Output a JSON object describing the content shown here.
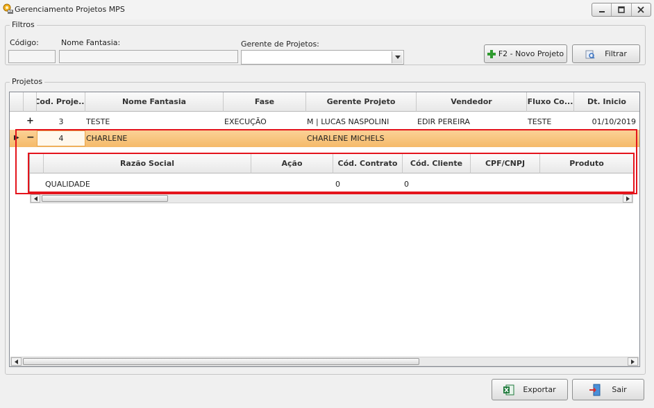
{
  "window": {
    "title": "Gerenciamento Projetos MPS",
    "icon": "app-logo-icon"
  },
  "filtros": {
    "legend": "Filtros",
    "codigo_label": "Código:",
    "codigo_value": "",
    "nome_fantasia_label": "Nome Fantasia:",
    "nome_fantasia_value": "",
    "gerente_label": "Gerente de Projetos:",
    "gerente_value": "",
    "novo_projeto_label": "F2 - Novo Projeto",
    "filtrar_label": "Filtrar"
  },
  "projetos": {
    "legend": "Projetos",
    "columns": [
      "Cod. Proje...",
      "Nome Fantasia",
      "Fase",
      "Gerente Projeto",
      "Vendedor",
      "Fluxo Co...",
      "Dt. Inicio"
    ],
    "rows": [
      {
        "expander": "+",
        "cod": "3",
        "nome": "TESTE",
        "fase": "EXECUÇÃO",
        "gerente": "M | LUCAS NASPOLINI",
        "vendedor": "EDIR PEREIRA",
        "fluxo": "TESTE",
        "dt_inicio": "01/10/2019"
      },
      {
        "expander": "−",
        "cod": "4",
        "nome": "CHARLENE",
        "fase": "",
        "gerente": "CHARLENE MICHELS",
        "vendedor": "",
        "fluxo": "",
        "dt_inicio": ""
      }
    ],
    "detail": {
      "columns": [
        "Razão Social",
        "Ação",
        "Cód. Contrato",
        "Cód. Cliente",
        "CPF/CNPJ",
        "Produto"
      ],
      "rows": [
        {
          "razao_social": "QUALIDADE",
          "acao": "",
          "cod_contrato": "0",
          "cod_cliente": "0",
          "cpf_cnpj": "",
          "produto": ""
        }
      ]
    }
  },
  "footer": {
    "exportar_label": "Exportar",
    "sair_label": "Sair"
  },
  "colors": {
    "selected_row": "#f7c27a",
    "highlight_border": "#e4141c",
    "accent_green": "#2f9a2f"
  }
}
